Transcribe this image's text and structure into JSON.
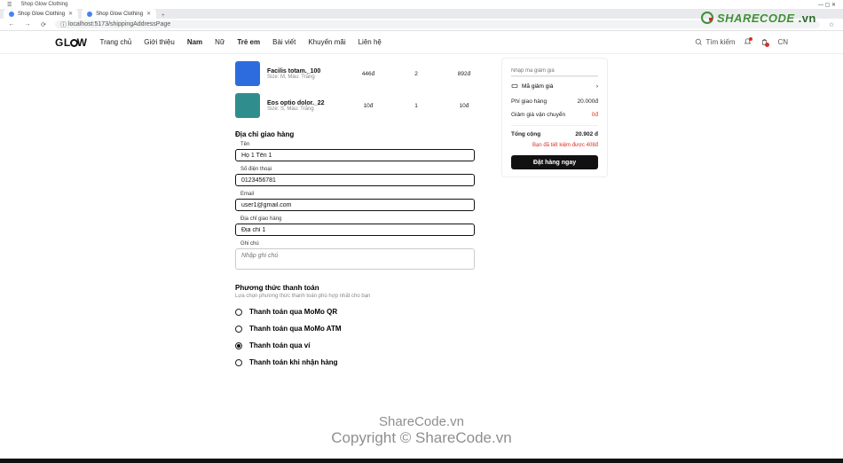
{
  "browser": {
    "title_left": "Shop Glow Clothing",
    "tab1": "Shop Glow Clothing",
    "tab2": "Shop Glow Clothing",
    "url": "localhost:5173/shippingAddressPage",
    "win_controls": "—  ▢  ✕"
  },
  "watermark": {
    "share": "SHARECODE",
    "vn": ".vn",
    "line1": "ShareCode.vn",
    "line2": "Copyright © ShareCode.vn"
  },
  "nav": {
    "logo": "GLOW",
    "links": [
      "Trang chủ",
      "Giới thiệu",
      "Nam",
      "Nữ",
      "Trẻ em",
      "Bài viết",
      "Khuyến mãi",
      "Liên hệ"
    ],
    "search_label": "Tìm kiếm",
    "account": "CN"
  },
  "cart": {
    "items": [
      {
        "name": "Facilis totam._100",
        "sub": "Size: M, Màu: Trắng",
        "price": "446đ",
        "qty": "2",
        "total": "892đ",
        "thumb": "blue"
      },
      {
        "name": "Eos optio dolor._22",
        "sub": "Size: S, Màu: Trắng",
        "price": "10đ",
        "qty": "1",
        "total": "10đ",
        "thumb": "teal"
      }
    ]
  },
  "shipping": {
    "title": "Địa chỉ giao hàng",
    "fields": {
      "name_label": "Tên",
      "name_value": "Họ 1 Tên 1",
      "phone_label": "Số điện thoại",
      "phone_value": "0123456781",
      "email_label": "Email",
      "email_value": "user1@gmail.com",
      "addr_label": "Địa chỉ giao hàng",
      "addr_value": "Địa chỉ 1",
      "note_label": "Ghi chú",
      "note_placeholder": "Nhập ghi chú"
    }
  },
  "payment": {
    "title": "Phương thức thanh toán",
    "sub": "Lựa chọn phương thức thanh toán phù hợp nhất cho bạn",
    "methods": [
      "Thanh toán qua MoMo QR",
      "Thanh toán qua MoMo ATM",
      "Thanh toán qua ví",
      "Thanh toán khi nhận hàng"
    ],
    "selected": 2
  },
  "summary": {
    "discount_placeholder": "Nhập mã giảm giá",
    "discount_label": "Mã giảm giá",
    "ship_label": "Phí giao hàng",
    "ship_value": "20.000đ",
    "shipdisc_label": "Giảm giá vận chuyển",
    "shipdisc_value": "0đ",
    "total_label": "Tổng cộng",
    "total_value": "20.902 đ",
    "saving": "Bạn đã tiết kiệm được 408đ",
    "order_btn": "Đặt hàng ngay"
  }
}
